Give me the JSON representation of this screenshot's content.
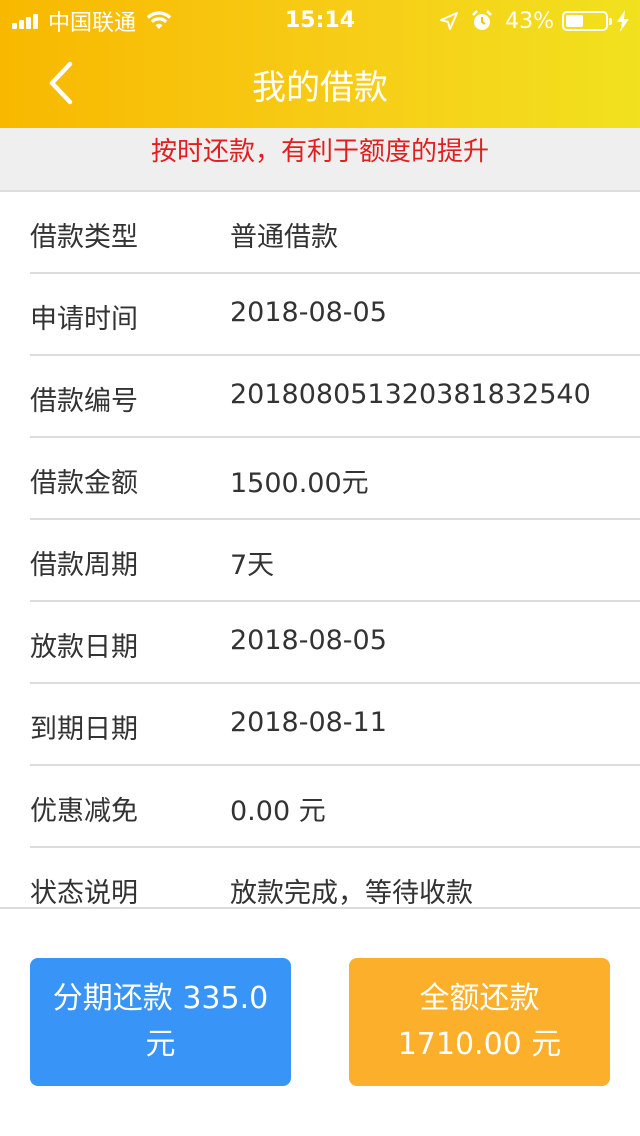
{
  "status_bar": {
    "carrier": "中国联通",
    "time": "15:14",
    "battery": "43%"
  },
  "nav": {
    "title": "我的借款"
  },
  "notice": "按时还款，有利于额度的提升",
  "details": [
    {
      "label": "借款类型",
      "value": "普通借款"
    },
    {
      "label": "申请时间",
      "value": "2018-08-05"
    },
    {
      "label": "借款编号",
      "value": "20180805132038183254​0"
    },
    {
      "label": "借款金额",
      "value": "1500.00元"
    },
    {
      "label": "借款周期",
      "value": "7天"
    },
    {
      "label": "放款日期",
      "value": "2018-08-05"
    },
    {
      "label": "到期日期",
      "value": "2018-08-11"
    },
    {
      "label": "优惠减免",
      "value": "0.00 元"
    },
    {
      "label": "状态说明",
      "value": "放款完成，等待收款"
    }
  ],
  "buttons": {
    "installment_line1": "分期还款 335.0",
    "installment_line2": "元",
    "full_line1": "全额还款",
    "full_line2": "1710.00 元"
  },
  "colors": {
    "header_start": "#f8b800",
    "header_end": "#f1e11e",
    "notice_text": "#e02020",
    "installment_button": "#3895f7",
    "full_button": "#fbaf2a"
  },
  "icons": {
    "back": "chevron-left-icon",
    "wifi": "wifi-icon",
    "location": "location-arrow-icon",
    "alarm": "alarm-icon",
    "charging": "lightning-icon"
  }
}
